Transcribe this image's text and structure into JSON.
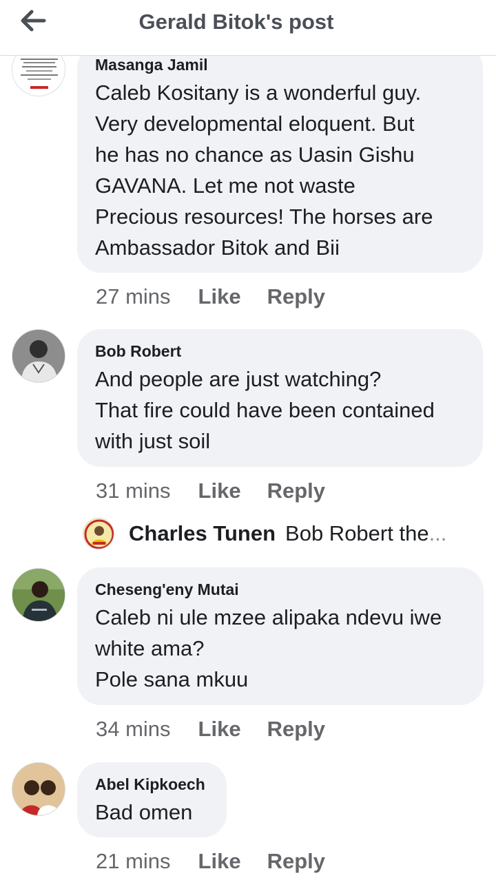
{
  "header": {
    "title": "Gerald Bitok's post",
    "back_icon": "arrow-left-icon"
  },
  "colors": {
    "bubble_bg": "#f0f2f5",
    "text": "#1c1e21",
    "secondary": "#65676b",
    "header_title": "#4b4f56"
  },
  "comments": [
    {
      "author": "Masanga Jamil",
      "text": "Caleb Kositany is a wonderful guy.\nVery developmental eloquent. But\nhe has no chance as Uasin Gishu\nGAVANA. Let me not waste\nPrecious resources! The horses are\nAmbassador Bitok and Bii",
      "time": "27 mins",
      "like": "Like",
      "reply": "Reply"
    },
    {
      "author": "Bob Robert",
      "text": "And people are just watching?\nThat fire could have been contained\nwith just soil",
      "time": "31 mins",
      "like": "Like",
      "reply": "Reply"
    },
    {
      "author": "Cheseng'eny Mutai",
      "text": "Caleb ni ule mzee alipaka ndevu iwe\nwhite ama?\nPole sana mkuu",
      "time": "34 mins",
      "like": "Like",
      "reply": "Reply"
    },
    {
      "author": "Abel Kipkoech",
      "text": "Bad omen",
      "time": "21 mins",
      "like": "Like",
      "reply": "Reply"
    }
  ],
  "reply_preview": {
    "author": "Charles Tunen",
    "snippet": "Bob Robert the",
    "ellipsis": "..."
  }
}
